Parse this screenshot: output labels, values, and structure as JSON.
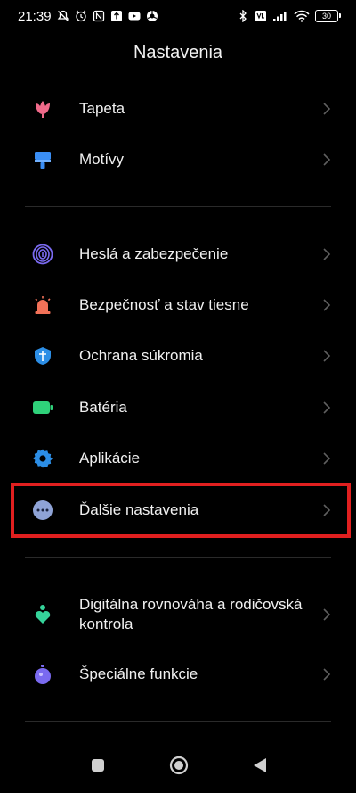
{
  "status_bar": {
    "time": "21:39",
    "battery": "30"
  },
  "header": {
    "title": "Nastavenia"
  },
  "colors": {
    "accent_highlight": "#e01f1f",
    "tapeta": "#f06a8a",
    "motivy": "#3a8ef5",
    "hesla": "#7a6af0",
    "bezpecnost": "#f27158",
    "ochrana": "#2c8ee6",
    "bateria": "#2fd17a",
    "aplikacie": "#2c8ee6",
    "dalsie": "#8fa3d6",
    "digitalna": "#35d39a",
    "specialne": "#7a6af0"
  },
  "items": [
    {
      "id": "tapeta",
      "label": "Tapeta",
      "icon": "tulip-icon"
    },
    {
      "id": "motivy",
      "label": "Motívy",
      "icon": "paint-brush-icon"
    },
    {
      "id": "hesla",
      "label": "Heslá a zabezpečenie",
      "icon": "fingerprint-icon"
    },
    {
      "id": "bezpecnost",
      "label": "Bezpečnosť a stav tiesne",
      "icon": "alarm-light-icon"
    },
    {
      "id": "ochrana",
      "label": "Ochrana súkromia",
      "icon": "privacy-shield-icon"
    },
    {
      "id": "bateria",
      "label": "Batéria",
      "icon": "battery-icon"
    },
    {
      "id": "aplikacie",
      "label": "Aplikácie",
      "icon": "gear-icon"
    },
    {
      "id": "dalsie",
      "label": "Ďalšie nastavenia",
      "icon": "more-dots-icon"
    },
    {
      "id": "digitalna",
      "label": "Digitálna rovnováha a rodičovská kontrola",
      "icon": "digital-wellbeing-icon"
    },
    {
      "id": "specialne",
      "label": "Špeciálne funkcie",
      "icon": "special-features-icon"
    }
  ]
}
